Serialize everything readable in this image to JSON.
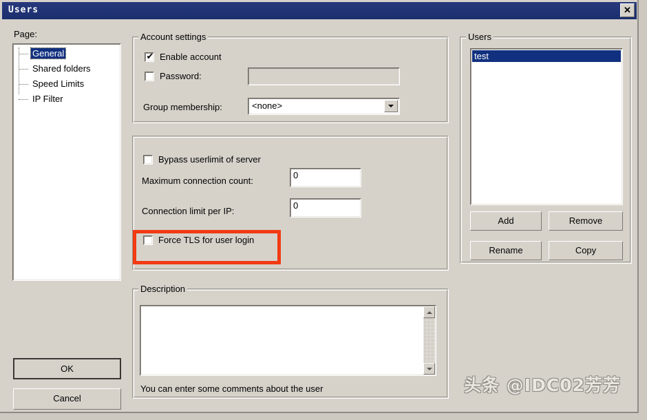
{
  "window": {
    "title": "Users",
    "close_label": "✕"
  },
  "page_panel": {
    "label": "Page:",
    "items": [
      {
        "label": "General",
        "selected": true
      },
      {
        "label": "Shared folders",
        "selected": false
      },
      {
        "label": "Speed Limits",
        "selected": false
      },
      {
        "label": "IP Filter",
        "selected": false
      }
    ]
  },
  "account_settings": {
    "title": "Account settings",
    "enable_account": {
      "label": "Enable account",
      "checked": true,
      "check_glyph": "✔"
    },
    "password": {
      "label": "Password:",
      "checked": false,
      "value": "",
      "disabled": true
    },
    "group_membership": {
      "label": "Group membership:",
      "value": "<none>"
    }
  },
  "limits": {
    "bypass_userlimit": {
      "label": "Bypass userlimit of server",
      "checked": false
    },
    "max_connection_count": {
      "label": "Maximum connection count:",
      "value": "0"
    },
    "connection_limit_per_ip": {
      "label": "Connection limit per IP:",
      "value": "0"
    },
    "force_tls": {
      "label": "Force TLS for user login",
      "checked": false,
      "highlighted": true,
      "highlight_color": "#f23a13"
    }
  },
  "description": {
    "title": "Description",
    "value": "",
    "hint": "You can enter some comments about the user"
  },
  "users": {
    "title": "Users",
    "items": [
      {
        "label": "test",
        "selected": true
      }
    ],
    "buttons": {
      "add": "Add",
      "remove": "Remove",
      "rename": "Rename",
      "copy": "Copy"
    }
  },
  "footer": {
    "ok": "OK",
    "cancel": "Cancel"
  },
  "watermark": {
    "text": "头条 @IDC02芳芳"
  }
}
